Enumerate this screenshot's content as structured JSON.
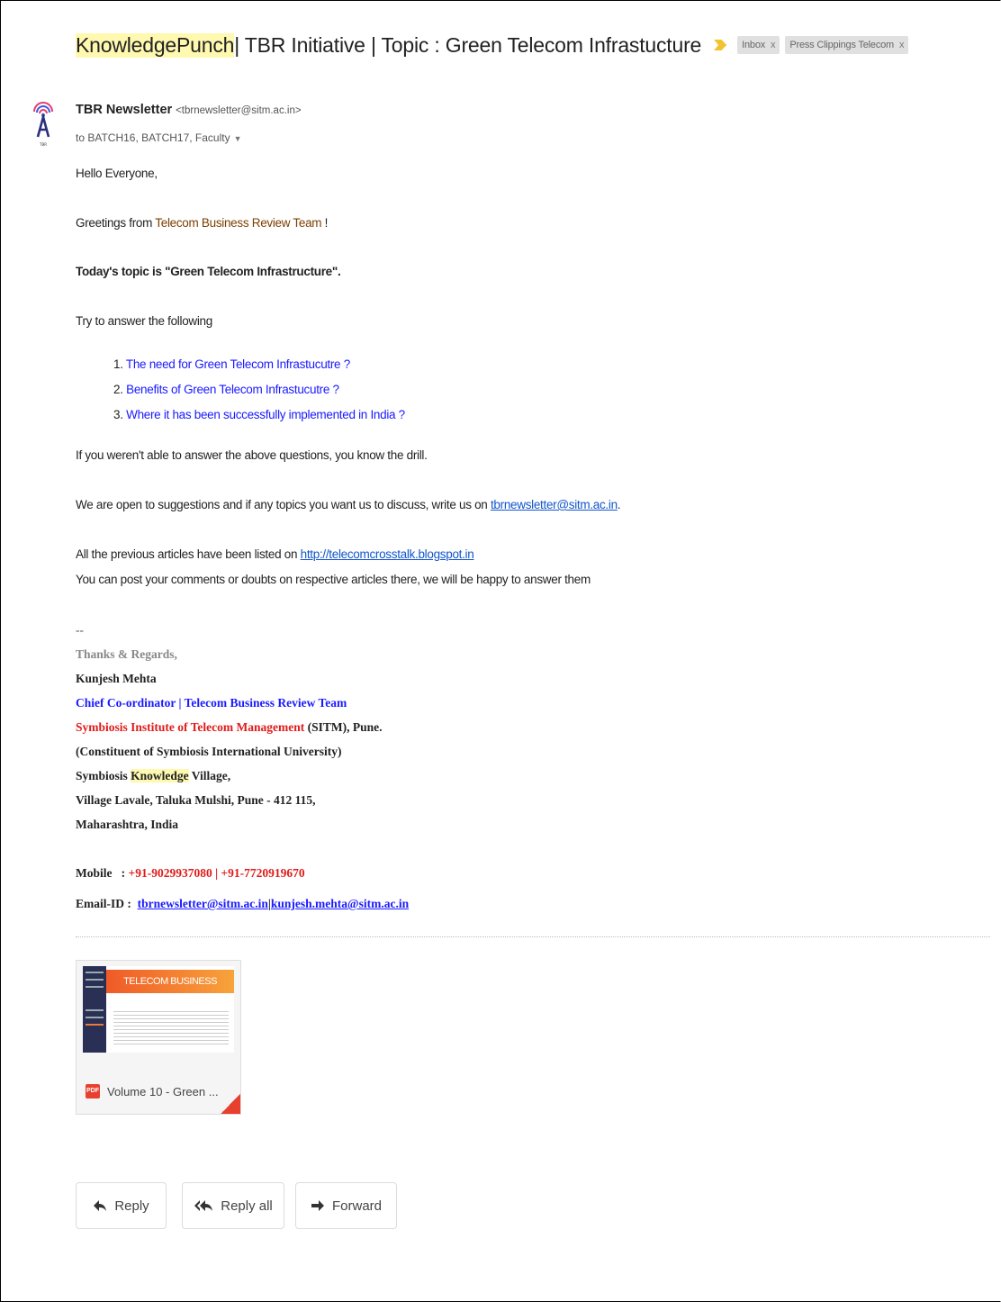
{
  "subject": {
    "parts": [
      "Knowledge",
      " ",
      "Punch",
      " | TBR Initiative | Topic : Green Telecom Infrastucture"
    ],
    "labels": [
      {
        "label": "Inbox",
        "close": "x"
      },
      {
        "label": "Press Clippings Telecom",
        "close": "x"
      }
    ]
  },
  "sender": {
    "name": "TBR Newsletter",
    "email": "<tbrnewsletter@sitm.ac.in>",
    "recipients": "to BATCH16, BATCH17, Faculty",
    "recipients_caret": "▼"
  },
  "body": {
    "greeting": "Hello Everyone,",
    "greetings_prefix": "Greetings from ",
    "greetings_team": "Telecom Business Review Team",
    "greetings_suffix": " !",
    "topic": "Today's topic is \"Green Telecom Infrastructure\".",
    "prompt": "Try to answer the following",
    "questions": [
      {
        "num": "1. ",
        "text": "The need for Green Telecom Infrastucutre ?"
      },
      {
        "num": "2. ",
        "text": "Benefits of Green Telecom Infrastucutre ?"
      },
      {
        "num": "3. ",
        "text": "Where it has been successfully implemented in India ?"
      }
    ],
    "drill": "If you weren't able to answer the above questions, you know the drill.",
    "suggest_prefix": "We are open to suggestions and if any topics you want us to discuss, write us on ",
    "suggest_link": "tbrnewsletter@sitm.ac.in",
    "suggest_suffix": ".",
    "articles_prefix": "All the previous articles have been listed on ",
    "articles_link": "http://telecomcrosstalk.blogspot.in",
    "comments": "You can post your comments or doubts on respective articles there, we will be happy to answer them"
  },
  "signature": {
    "dashes": "--",
    "regards": "Thanks & Regards,",
    "name": "Kunjesh Mehta",
    "title": "Chief Co-ordinator | Telecom Business Review Team",
    "institute": "Symbiosis Institute of Telecom Management",
    "institute_suffix": " (SITM), Pune.",
    "constituent": "(Constituent of Symbiosis International University)",
    "village_prefix": "Symbiosis ",
    "village_hl": "Knowledge",
    "village_suffix": " Village,",
    "address": "Village Lavale, Taluka Mulshi, Pune - 412 115,",
    "state": "Maharashtra, India",
    "mobile_label": "Mobile   : ",
    "mobile_numbers": "+91-9029937080 | +91-7720919670",
    "email_label": "Email-ID :  ",
    "email1": "tbrnewsletter@sitm.ac.in",
    "email_sep": "|",
    "email2": "kunjesh.mehta@sitm.ac.in"
  },
  "attachment": {
    "type_badge": "PDF",
    "name": "Volume 10 - Green ...",
    "thumb_title": "TELECOM BUSINESS REVIEW"
  },
  "actions": {
    "reply": "Reply",
    "reply_all": "Reply all",
    "forward": "Forward"
  }
}
